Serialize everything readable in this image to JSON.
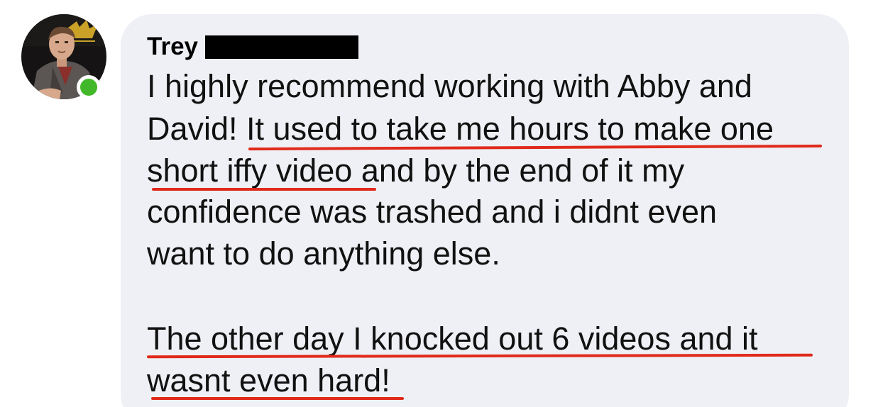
{
  "comment": {
    "author": "Trey",
    "author_redacted": true,
    "avatar_status": "online",
    "lines": [
      "I highly recommend working with Abby and",
      "David! It used to take me hours to make one",
      "short iffy video and by the end of it my",
      "confidence was trashed and i didnt even",
      "want to do anything else.",
      "The other day I knocked out 6 videos and it",
      "wasnt even hard!"
    ]
  },
  "colors": {
    "bubble": "#eff0f5",
    "underline": "#e02a1b",
    "online": "#42b72a",
    "text": "#111111"
  }
}
